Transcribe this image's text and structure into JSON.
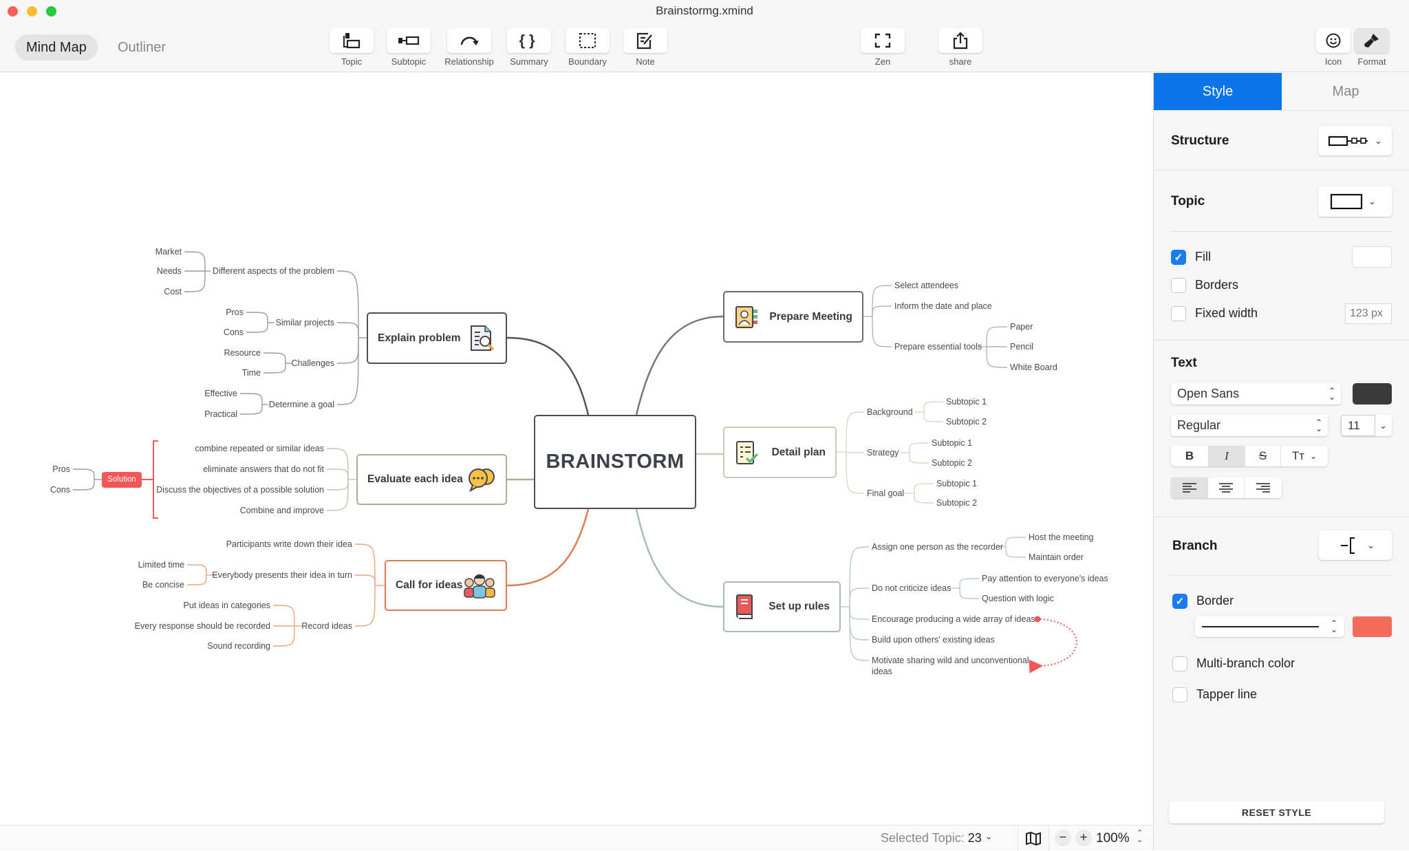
{
  "window": {
    "title": "Brainstormg.xmind"
  },
  "view_tabs": {
    "mind_map": "Mind Map",
    "outliner": "Outliner",
    "active": "Mind Map"
  },
  "toolbar": {
    "topic": "Topic",
    "subtopic": "Subtopic",
    "relationship": "Relationship",
    "summary": "Summary",
    "boundary": "Boundary",
    "note": "Note",
    "zen": "Zen",
    "share": "share",
    "icon": "Icon",
    "format": "Format"
  },
  "mindmap": {
    "central": "BRAINSTORM",
    "explain": {
      "label": "Explain problem",
      "children": [
        {
          "label": "Different aspects of the problem",
          "children": [
            "Market",
            "Needs",
            "Cost"
          ]
        },
        {
          "label": "Similar projects",
          "children": [
            "Pros",
            "Cons"
          ]
        },
        {
          "label": "Challenges",
          "children": [
            "Resource",
            "Time"
          ]
        },
        {
          "label": "Determine a goal",
          "children": [
            "Effective",
            "Practical"
          ]
        }
      ]
    },
    "evaluate": {
      "label": "Evaluate each idea",
      "children": [
        "combine repeated or similar ideas",
        "eliminate answers that do not fit",
        "Discuss the objectives of a possible solution",
        "Combine and improve"
      ],
      "summary": {
        "label": "Solution",
        "children": [
          "Pros",
          "Cons"
        ]
      }
    },
    "call": {
      "label": "Call for ideas",
      "children": [
        {
          "label": "Participants write down their idea",
          "children": []
        },
        {
          "label": "Everybody presents their idea in turn",
          "children": [
            "Limited time",
            "Be concise"
          ]
        },
        {
          "label": "Record ideas",
          "children": [
            "Put ideas in categories",
            "Every response should be recorded",
            "Sound recording"
          ]
        }
      ]
    },
    "prepare": {
      "label": "Prepare Meeting",
      "children": [
        {
          "label": "Select attendees",
          "children": []
        },
        {
          "label": "Inform the date and place",
          "children": []
        },
        {
          "label": "Prepare essential tools",
          "children": [
            "Paper",
            "Pencil",
            "White Board"
          ]
        }
      ]
    },
    "detail": {
      "label": "Detail plan",
      "children": [
        {
          "label": "Background",
          "children": [
            "Subtopic 1",
            "Subtopic 2"
          ]
        },
        {
          "label": "Strategy",
          "children": [
            "Subtopic 1",
            "Subtopic 2"
          ]
        },
        {
          "label": "Final goal",
          "children": [
            "Subtopic 1",
            "Subtopic 2"
          ]
        }
      ]
    },
    "rules": {
      "label": "Set up rules",
      "children": [
        {
          "label": "Assign one person as the recorder",
          "children": [
            "Host the meeting",
            "Maintain order"
          ]
        },
        {
          "label": "Do not criticize ideas",
          "children": [
            "Pay attention to everyone's ideas",
            "Question with logic"
          ]
        },
        {
          "label": "Encourage producing a wide array of ideas",
          "children": []
        },
        {
          "label": "Build upon others' existing ideas",
          "children": []
        },
        {
          "label": "Motivate sharing wild and unconventional ideas",
          "children": []
        }
      ]
    },
    "colors": {
      "relationship": "#f25757",
      "summary": "#f25757",
      "call": "#e07b4f",
      "evaluate": "#b3a898"
    }
  },
  "panel": {
    "tabs": {
      "style": "Style",
      "map": "Map",
      "active": "Style"
    },
    "structure": {
      "label": "Structure"
    },
    "topic": {
      "label": "Topic",
      "fill": "Fill",
      "fill_checked": true,
      "borders": "Borders",
      "borders_checked": false,
      "fixed_width": "Fixed width",
      "fixed_width_checked": false,
      "width_placeholder": "123 px",
      "fill_color": "#ffffff"
    },
    "text": {
      "label": "Text",
      "font": "Open Sans",
      "weight": "Regular",
      "size": "11",
      "color": "#3a3a3a",
      "bold": "B",
      "italic": "I",
      "strike": "S",
      "case": "Tт",
      "italic_active": true,
      "align_active": "left"
    },
    "branch": {
      "label": "Branch",
      "border": "Border",
      "border_checked": true,
      "border_color": "#f36b5b",
      "multi_branch": "Multi-branch color",
      "multi_branch_checked": false,
      "tapper": "Tapper line",
      "tapper_checked": false
    },
    "reset": "RESET STYLE"
  },
  "status": {
    "selected_label": "Selected Topic:",
    "selected_count": "23",
    "zoom": "100%",
    "minus": "−",
    "plus": "+"
  }
}
